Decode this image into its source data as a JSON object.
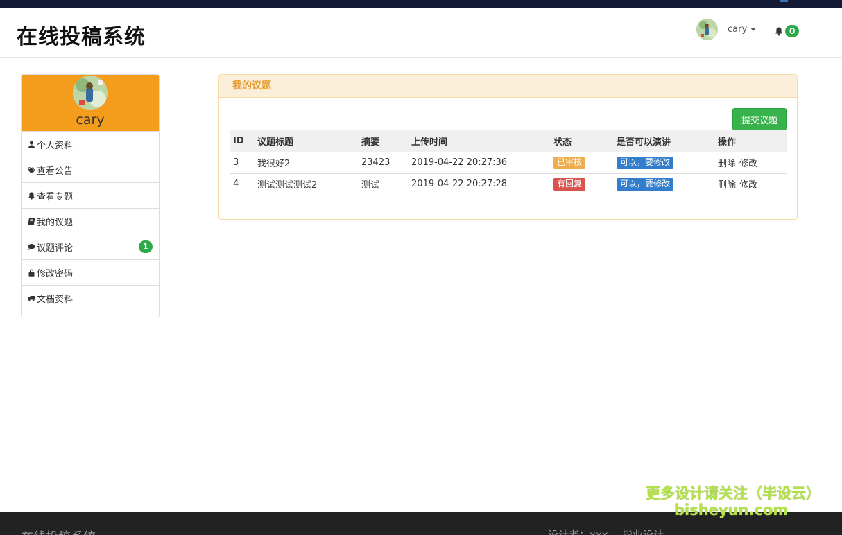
{
  "app": {
    "brand": "在线投稿系统"
  },
  "header": {
    "user_name": "cary",
    "notification_count": "0"
  },
  "sidebar": {
    "profile_name": "cary",
    "items": [
      {
        "label": "个人资料",
        "icon": "user-icon"
      },
      {
        "label": "查看公告",
        "icon": "tags-icon"
      },
      {
        "label": "查看专题",
        "icon": "bell-icon"
      },
      {
        "label": "我的议题",
        "icon": "book-icon"
      },
      {
        "label": "议题评论",
        "icon": "comment-icon",
        "badge": "1"
      },
      {
        "label": "修改密码",
        "icon": "unlock-icon"
      },
      {
        "label": "文档资料",
        "icon": "truck-icon"
      }
    ]
  },
  "panel": {
    "title": "我的议题",
    "submit_label": "提交议题",
    "columns": [
      "ID",
      "议题标题",
      "摘要",
      "上传时间",
      "状态",
      "是否可以演讲",
      "操作"
    ],
    "rows": [
      {
        "id": "3",
        "title": "我很好2",
        "summary": "23423",
        "time": "2019-04-22 20:27:36",
        "status": "已审核",
        "status_color": "#f0ad4e",
        "speech": "可以，要修改",
        "speech_color": "#337ecc",
        "delete": "删除",
        "edit": "修改"
      },
      {
        "id": "4",
        "title": "测试测试测试2",
        "summary": "测试",
        "time": "2019-04-22 20:27:28",
        "status": "有回复",
        "status_color": "#d9534f",
        "speech": "可以，要修改",
        "speech_color": "#337ecc",
        "delete": "删除",
        "edit": "修改"
      }
    ]
  },
  "watermark": {
    "line1": "更多设计请关注（毕设云）",
    "line2": "bisheyun.com"
  },
  "footer": {
    "brand": "在线投稿系统",
    "designer": "设计者：xxx",
    "note": "毕业设计"
  },
  "colors": {
    "accent": "#f49c1b",
    "success": "#38b34b",
    "panel_header": "#fcefd9"
  }
}
